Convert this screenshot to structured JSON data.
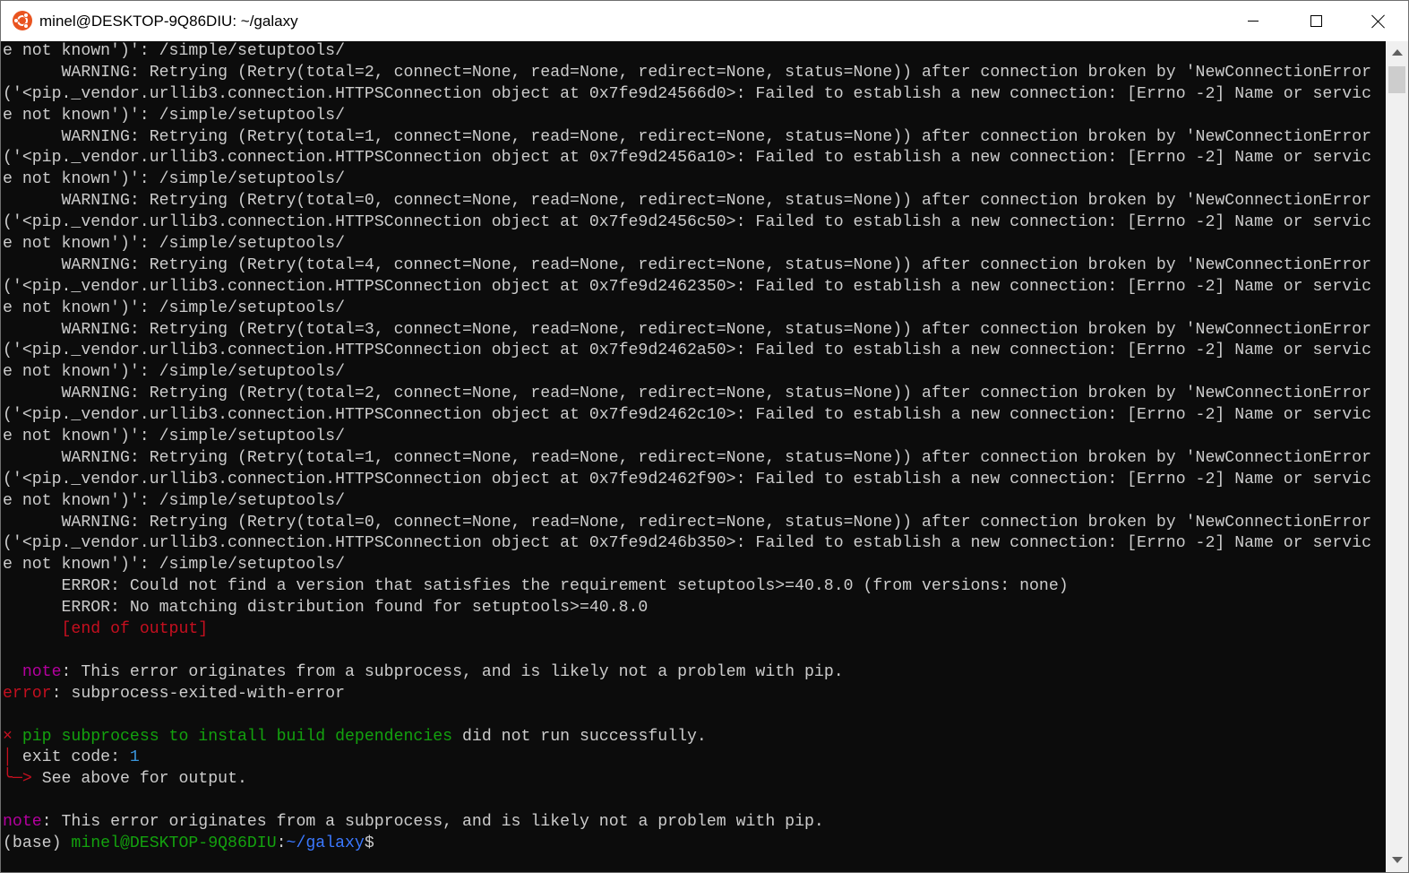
{
  "window": {
    "title": "minel@DESKTOP-9Q86DIU: ~/galaxy",
    "app_icon": "ubuntu-icon",
    "controls": [
      "minimize-icon",
      "maximize-icon",
      "close-icon"
    ]
  },
  "terminal": {
    "colors": {
      "background": "#0c0c0c",
      "foreground": "#cccccc",
      "red": "#c50f1f",
      "magenta": "#b4009e",
      "green": "#13a10e",
      "blue": "#3b78ff",
      "cyan": "#3a96dd"
    },
    "lines": [
      [
        {
          "t": "e not known')': /simple/setuptools/"
        }
      ],
      [
        {
          "t": "      WARNING: Retrying (Retry(total=2, connect=None, read=None, redirect=None, status=None)) after connection broken by 'NewConnectionError"
        }
      ],
      [
        {
          "t": "('<pip._vendor.urllib3.connection.HTTPSConnection object at 0x7fe9d24566d0>: Failed to establish a new connection: [Errno -2] Name or servic"
        }
      ],
      [
        {
          "t": "e not known')': /simple/setuptools/"
        }
      ],
      [
        {
          "t": "      WARNING: Retrying (Retry(total=1, connect=None, read=None, redirect=None, status=None)) after connection broken by 'NewConnectionError"
        }
      ],
      [
        {
          "t": "('<pip._vendor.urllib3.connection.HTTPSConnection object at 0x7fe9d2456a10>: Failed to establish a new connection: [Errno -2] Name or servic"
        }
      ],
      [
        {
          "t": "e not known')': /simple/setuptools/"
        }
      ],
      [
        {
          "t": "      WARNING: Retrying (Retry(total=0, connect=None, read=None, redirect=None, status=None)) after connection broken by 'NewConnectionError"
        }
      ],
      [
        {
          "t": "('<pip._vendor.urllib3.connection.HTTPSConnection object at 0x7fe9d2456c50>: Failed to establish a new connection: [Errno -2] Name or servic"
        }
      ],
      [
        {
          "t": "e not known')': /simple/setuptools/"
        }
      ],
      [
        {
          "t": "      WARNING: Retrying (Retry(total=4, connect=None, read=None, redirect=None, status=None)) after connection broken by 'NewConnectionError"
        }
      ],
      [
        {
          "t": "('<pip._vendor.urllib3.connection.HTTPSConnection object at 0x7fe9d2462350>: Failed to establish a new connection: [Errno -2] Name or servic"
        }
      ],
      [
        {
          "t": "e not known')': /simple/setuptools/"
        }
      ],
      [
        {
          "t": "      WARNING: Retrying (Retry(total=3, connect=None, read=None, redirect=None, status=None)) after connection broken by 'NewConnectionError"
        }
      ],
      [
        {
          "t": "('<pip._vendor.urllib3.connection.HTTPSConnection object at 0x7fe9d2462a50>: Failed to establish a new connection: [Errno -2] Name or servic"
        }
      ],
      [
        {
          "t": "e not known')': /simple/setuptools/"
        }
      ],
      [
        {
          "t": "      WARNING: Retrying (Retry(total=2, connect=None, read=None, redirect=None, status=None)) after connection broken by 'NewConnectionError"
        }
      ],
      [
        {
          "t": "('<pip._vendor.urllib3.connection.HTTPSConnection object at 0x7fe9d2462c10>: Failed to establish a new connection: [Errno -2] Name or servic"
        }
      ],
      [
        {
          "t": "e not known')': /simple/setuptools/"
        }
      ],
      [
        {
          "t": "      WARNING: Retrying (Retry(total=1, connect=None, read=None, redirect=None, status=None)) after connection broken by 'NewConnectionError"
        }
      ],
      [
        {
          "t": "('<pip._vendor.urllib3.connection.HTTPSConnection object at 0x7fe9d2462f90>: Failed to establish a new connection: [Errno -2] Name or servic"
        }
      ],
      [
        {
          "t": "e not known')': /simple/setuptools/"
        }
      ],
      [
        {
          "t": "      WARNING: Retrying (Retry(total=0, connect=None, read=None, redirect=None, status=None)) after connection broken by 'NewConnectionError"
        }
      ],
      [
        {
          "t": "('<pip._vendor.urllib3.connection.HTTPSConnection object at 0x7fe9d246b350>: Failed to establish a new connection: [Errno -2] Name or servic"
        }
      ],
      [
        {
          "t": "e not known')': /simple/setuptools/"
        }
      ],
      [
        {
          "t": "      ERROR: Could not find a version that satisfies the requirement setuptools>=40.8.0 (from versions: none)"
        }
      ],
      [
        {
          "t": "      ERROR: No matching distribution found for setuptools>=40.8.0"
        }
      ],
      [
        {
          "t": "      "
        },
        {
          "t": "[end of output]",
          "c": "red"
        }
      ],
      [
        {
          "t": ""
        }
      ],
      [
        {
          "t": "  "
        },
        {
          "t": "note",
          "c": "magenta"
        },
        {
          "t": ": This error originates from a subprocess, and is likely not a problem with pip."
        }
      ],
      [
        {
          "t": "error",
          "c": "red"
        },
        {
          "t": ": subprocess-exited-with-error"
        }
      ],
      [
        {
          "t": ""
        }
      ],
      [
        {
          "t": "×",
          "c": "red"
        },
        {
          "t": " "
        },
        {
          "t": "pip subprocess to install build dependencies",
          "c": "green"
        },
        {
          "t": " did not run successfully."
        }
      ],
      [
        {
          "t": "│",
          "c": "red"
        },
        {
          "t": " exit code: "
        },
        {
          "t": "1",
          "c": "cyan"
        }
      ],
      [
        {
          "t": "╰─>",
          "c": "red"
        },
        {
          "t": " See above for output."
        }
      ],
      [
        {
          "t": ""
        }
      ],
      [
        {
          "t": "note",
          "c": "magenta"
        },
        {
          "t": ": This error originates from a subprocess, and is likely not a problem with pip."
        }
      ],
      [
        {
          "t": "(base) "
        },
        {
          "t": "minel@DESKTOP-9Q86DIU",
          "c": "green"
        },
        {
          "t": ":"
        },
        {
          "t": "~/galaxy",
          "c": "blue"
        },
        {
          "t": "$"
        }
      ]
    ]
  }
}
